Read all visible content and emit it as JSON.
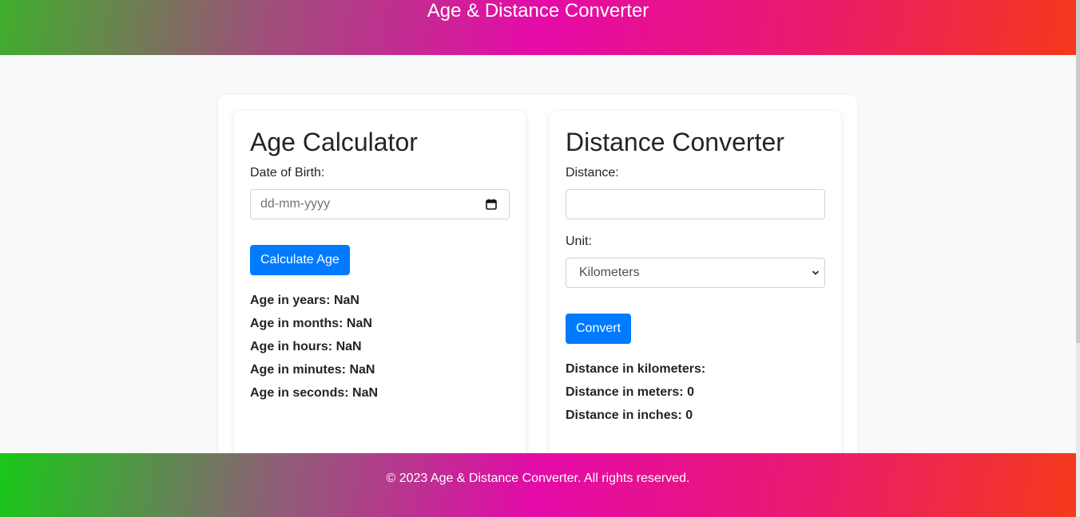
{
  "header": {
    "title": "Age & Distance Converter"
  },
  "age_card": {
    "title": "Age Calculator",
    "dob_label": "Date of Birth:",
    "dob_placeholder": "dd-mm-yyyy",
    "button_label": "Calculate Age",
    "results": [
      {
        "label": "Age in years:",
        "value": "NaN"
      },
      {
        "label": "Age in months:",
        "value": "NaN"
      },
      {
        "label": "Age in hours:",
        "value": "NaN"
      },
      {
        "label": "Age in minutes:",
        "value": "NaN"
      },
      {
        "label": "Age in seconds:",
        "value": "NaN"
      }
    ]
  },
  "distance_card": {
    "title": "Distance Converter",
    "distance_label": "Distance:",
    "distance_value": "",
    "unit_label": "Unit:",
    "unit_selected": "Kilometers",
    "button_label": "Convert",
    "results": [
      {
        "label": "Distance in kilometers:",
        "value": ""
      },
      {
        "label": "Distance in meters:",
        "value": "0"
      },
      {
        "label": "Distance in inches:",
        "value": "0"
      }
    ]
  },
  "footer": {
    "text": "© 2023 Age & Distance Converter. All rights reserved."
  },
  "colors": {
    "button": "#007bff",
    "gradient_left": "#18c818",
    "gradient_mid": "#e60aa8",
    "gradient_right": "#f4381a"
  },
  "icons": {
    "date_picker": "calendar-icon",
    "select": "chevron-down-icon"
  }
}
